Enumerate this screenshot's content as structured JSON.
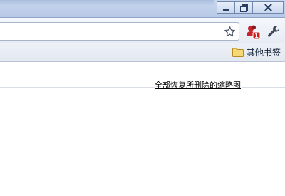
{
  "window_controls": {
    "minimize": "minimize",
    "restore": "restore",
    "close": "close"
  },
  "toolbar": {
    "bookmark_star_icon": "star-icon",
    "extension_icon": "extension-user-icon",
    "extension_badge": "1",
    "settings_icon": "wrench-icon"
  },
  "bookmarks_bar": {
    "other_bookmarks_label": "其他书签",
    "folder_icon": "folder-icon"
  },
  "content": {
    "restore_link_text": "全部恢复所删除的缩略图"
  },
  "colors": {
    "titlebar": "#c2d3ec",
    "badge_red": "#cc1f1f",
    "folder_yellow": "#f2c94c"
  }
}
